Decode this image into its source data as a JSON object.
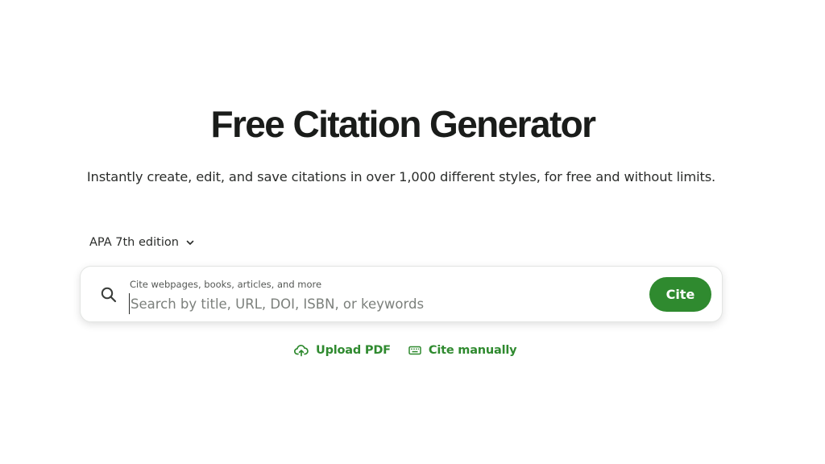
{
  "hero": {
    "title": "Free Citation Generator",
    "subtitle": "Instantly create, edit, and save citations in over 1,000 different styles, for free and without limits."
  },
  "style_selector": {
    "selected": "APA 7th edition",
    "icon": "chevron-down-icon"
  },
  "search": {
    "icon": "search-icon",
    "label": "Cite webpages, books, articles, and more",
    "placeholder": "Search by title, URL, DOI, ISBN, or keywords",
    "value": "",
    "button_label": "Cite"
  },
  "actions": [
    {
      "label": "Upload PDF",
      "icon": "cloud-upload-icon"
    },
    {
      "label": "Cite manually",
      "icon": "keyboard-icon"
    }
  ],
  "colors": {
    "accent": "#2f8a2f",
    "text": "#1a1c1a",
    "muted": "#7c807c"
  }
}
